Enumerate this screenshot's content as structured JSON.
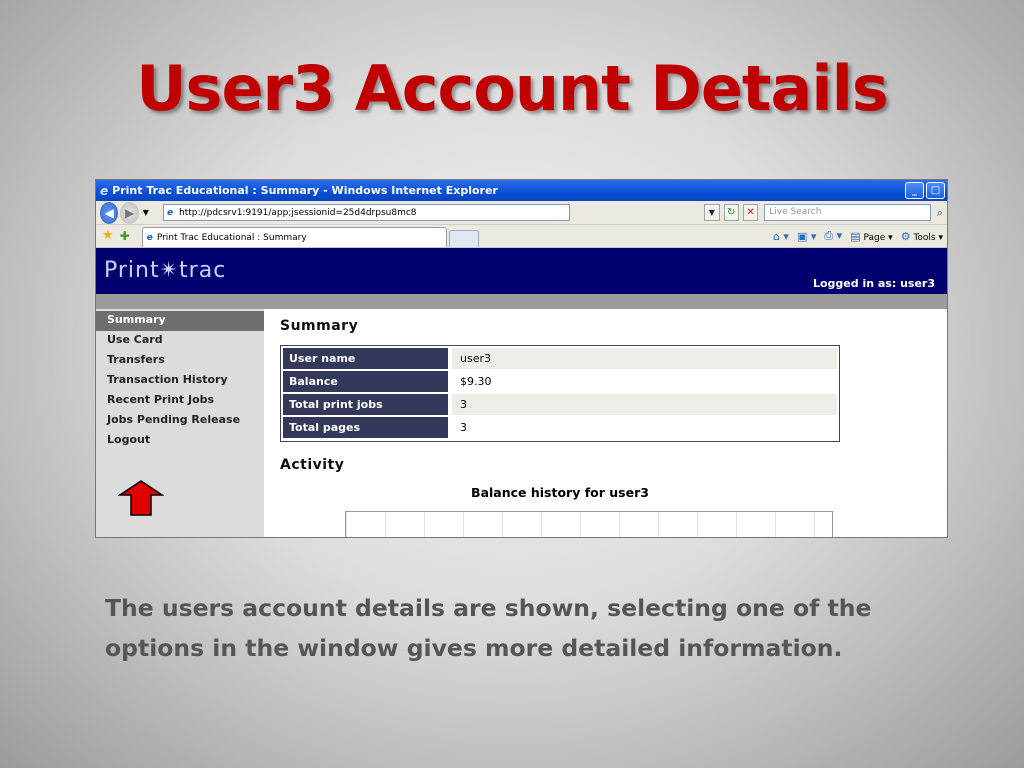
{
  "slide": {
    "title": "User3 Account Details",
    "caption": "The users account details are shown, selecting one of the options in the window gives more detailed information."
  },
  "browser": {
    "window_title": "Print Trac Educational : Summary - Windows Internet Explorer",
    "address": "http://pdcsrv1:9191/app;jsessionid=25d4drpsu8mc8",
    "search_placeholder": "Live Search",
    "tab_label": "Print Trac Educational : Summary",
    "page_menu": "Page",
    "tools_menu": "Tools"
  },
  "app": {
    "logo": "Print✴trac",
    "logged_in": "Logged in as:  user3",
    "nav": [
      {
        "label": "Summary"
      },
      {
        "label": "Use Card"
      },
      {
        "label": "Transfers"
      },
      {
        "label": "Transaction History"
      },
      {
        "label": "Recent Print Jobs"
      },
      {
        "label": "Jobs Pending Release"
      },
      {
        "label": "Logout"
      }
    ],
    "summary_heading": "Summary",
    "summary": [
      {
        "key": "User name",
        "value": "user3"
      },
      {
        "key": "Balance",
        "value": "$9.30"
      },
      {
        "key": "Total print jobs",
        "value": "3"
      },
      {
        "key": "Total pages",
        "value": "3"
      }
    ],
    "activity_heading": "Activity",
    "chart_title": "Balance history for user3"
  },
  "colors": {
    "title_red": "#c00000",
    "header_navy": "#00006e",
    "table_key_bg": "#34385a",
    "arrow_red": "#e00000"
  }
}
